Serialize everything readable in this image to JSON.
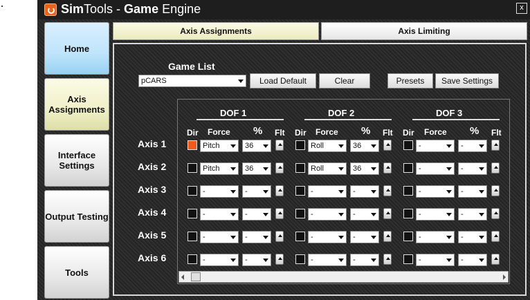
{
  "app": {
    "title_bold_a": "Sim",
    "title_a": "Tools - ",
    "title_bold_b": "Game",
    "title_b": " Engine",
    "close": "x"
  },
  "nav": [
    "Home",
    "Axis Assignments",
    "Interface Settings",
    "Output Testing",
    "Tools"
  ],
  "tabs": [
    "Axis Assignments",
    "Axis Limiting"
  ],
  "game_list": {
    "label": "Game List",
    "selected": "pCARS"
  },
  "buttons": {
    "load_default": "Load Default",
    "clear": "Clear",
    "presets": "Presets",
    "save_settings": "Save Settings"
  },
  "dof_headers": [
    "DOF 1",
    "DOF 2",
    "DOF 3"
  ],
  "col_headers": {
    "dir": "Dir",
    "force": "Force",
    "pct": "%",
    "flt": "Flt"
  },
  "axes": [
    {
      "name": "Axis 1",
      "dof": [
        {
          "dir": true,
          "force": "Pitch",
          "pct": "36"
        },
        {
          "dir": false,
          "force": "Roll",
          "pct": "36"
        },
        {
          "dir": false,
          "force": "-",
          "pct": "-"
        }
      ]
    },
    {
      "name": "Axis 2",
      "dof": [
        {
          "dir": false,
          "force": "Pitch",
          "pct": "36"
        },
        {
          "dir": false,
          "force": "Roll",
          "pct": "36"
        },
        {
          "dir": false,
          "force": "-",
          "pct": "-"
        }
      ]
    },
    {
      "name": "Axis 3",
      "dof": [
        {
          "dir": false,
          "force": "-",
          "pct": "-"
        },
        {
          "dir": false,
          "force": "-",
          "pct": "-"
        },
        {
          "dir": false,
          "force": "-",
          "pct": "-"
        }
      ]
    },
    {
      "name": "Axis 4",
      "dof": [
        {
          "dir": false,
          "force": "-",
          "pct": "-"
        },
        {
          "dir": false,
          "force": "-",
          "pct": "-"
        },
        {
          "dir": false,
          "force": "-",
          "pct": "-"
        }
      ]
    },
    {
      "name": "Axis 5",
      "dof": [
        {
          "dir": false,
          "force": "-",
          "pct": "-"
        },
        {
          "dir": false,
          "force": "-",
          "pct": "-"
        },
        {
          "dir": false,
          "force": "-",
          "pct": "-"
        }
      ]
    },
    {
      "name": "Axis 6",
      "dof": [
        {
          "dir": false,
          "force": "-",
          "pct": "-"
        },
        {
          "dir": false,
          "force": "-",
          "pct": "-"
        },
        {
          "dir": false,
          "force": "-",
          "pct": "-"
        }
      ]
    }
  ],
  "colors": {
    "accent_checked": "#f05a1a",
    "tab_active": "#f0f0c8",
    "home": "#bfe4fb"
  }
}
